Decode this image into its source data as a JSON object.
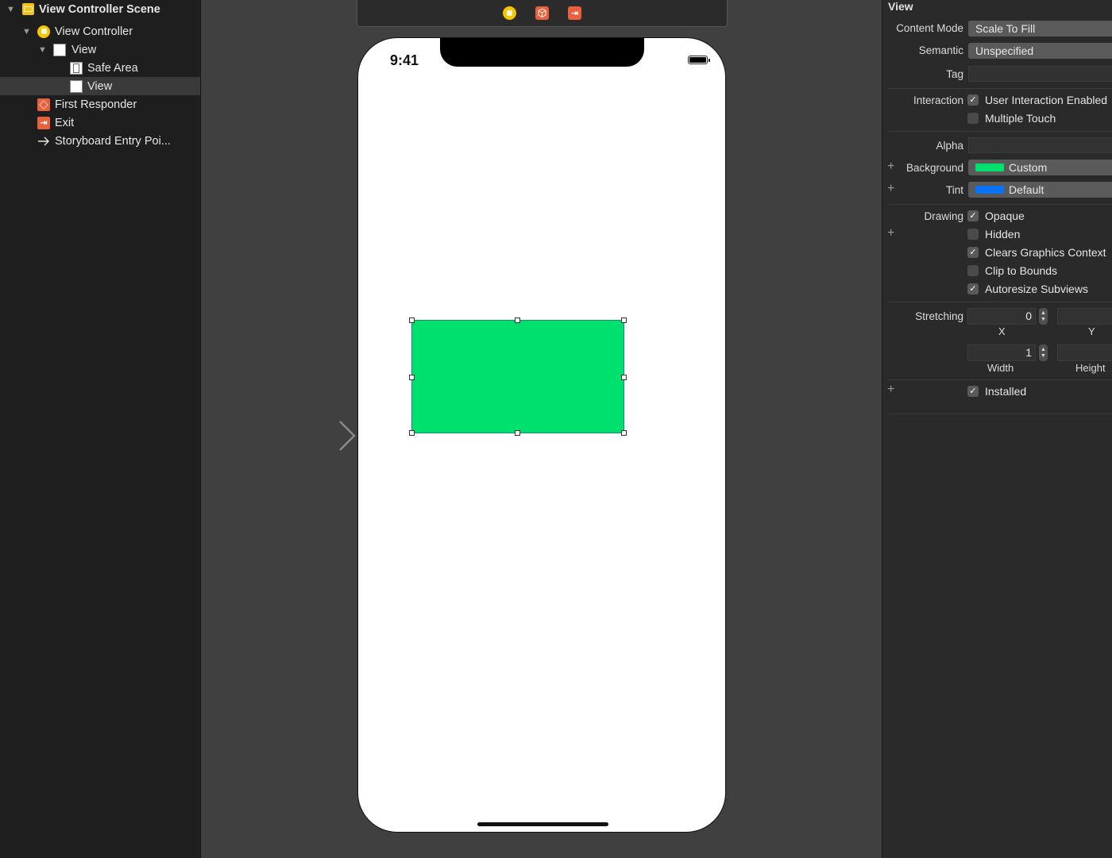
{
  "outline": {
    "items": [
      {
        "label": "View Controller Scene"
      },
      {
        "label": "View Controller"
      },
      {
        "label": "View"
      },
      {
        "label": "Safe Area"
      },
      {
        "label": "View"
      },
      {
        "label": "First Responder"
      },
      {
        "label": "Exit"
      },
      {
        "label": "Storyboard Entry Poi..."
      }
    ]
  },
  "canvas": {
    "status_time": "9:41",
    "dock_icons": [
      "view-controller-icon",
      "first-responder-icon",
      "exit-icon"
    ],
    "selected_view_color": "#00e06f"
  },
  "inspector": {
    "title": "View",
    "content_mode": {
      "label": "Content Mode",
      "value": "Scale To Fill"
    },
    "semantic": {
      "label": "Semantic",
      "value": "Unspecified"
    },
    "tag": {
      "label": "Tag",
      "value": ""
    },
    "interaction": {
      "label": "Interaction",
      "options": [
        {
          "label": "User Interaction Enabled",
          "checked": true
        },
        {
          "label": "Multiple Touch",
          "checked": false
        }
      ]
    },
    "alpha": {
      "label": "Alpha",
      "value": ""
    },
    "background": {
      "label": "Background",
      "value": "Custom",
      "color": "#00e06f"
    },
    "tint": {
      "label": "Tint",
      "value": "Default",
      "color": "#0a73f5"
    },
    "drawing": {
      "label": "Drawing",
      "options": [
        {
          "label": "Opaque",
          "checked": true
        },
        {
          "label": "Hidden",
          "checked": false
        },
        {
          "label": "Clears Graphics Context",
          "checked": true
        },
        {
          "label": "Clip to Bounds",
          "checked": false
        },
        {
          "label": "Autoresize Subviews",
          "checked": true
        }
      ]
    },
    "stretching": {
      "label": "Stretching",
      "x": "0",
      "x_label": "X",
      "y_label": "Y",
      "width": "1",
      "width_label": "Width",
      "height_label": "Height"
    },
    "installed": {
      "label": "Installed",
      "checked": true
    }
  }
}
